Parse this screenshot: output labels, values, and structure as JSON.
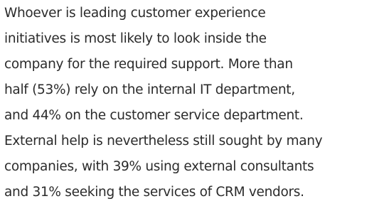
{
  "paragraph": {
    "lines": [
      "Whoever is leading customer experience",
      "initiatives is most likely to look inside the",
      "company for the required support. More than",
      "half (53%) rely on the internal IT department,",
      "and 44% on the customer service department.",
      "External help is nevertheless still sought by many",
      "companies, with 39% using external consultants",
      "and 31% seeking the services of CRM vendors."
    ]
  }
}
